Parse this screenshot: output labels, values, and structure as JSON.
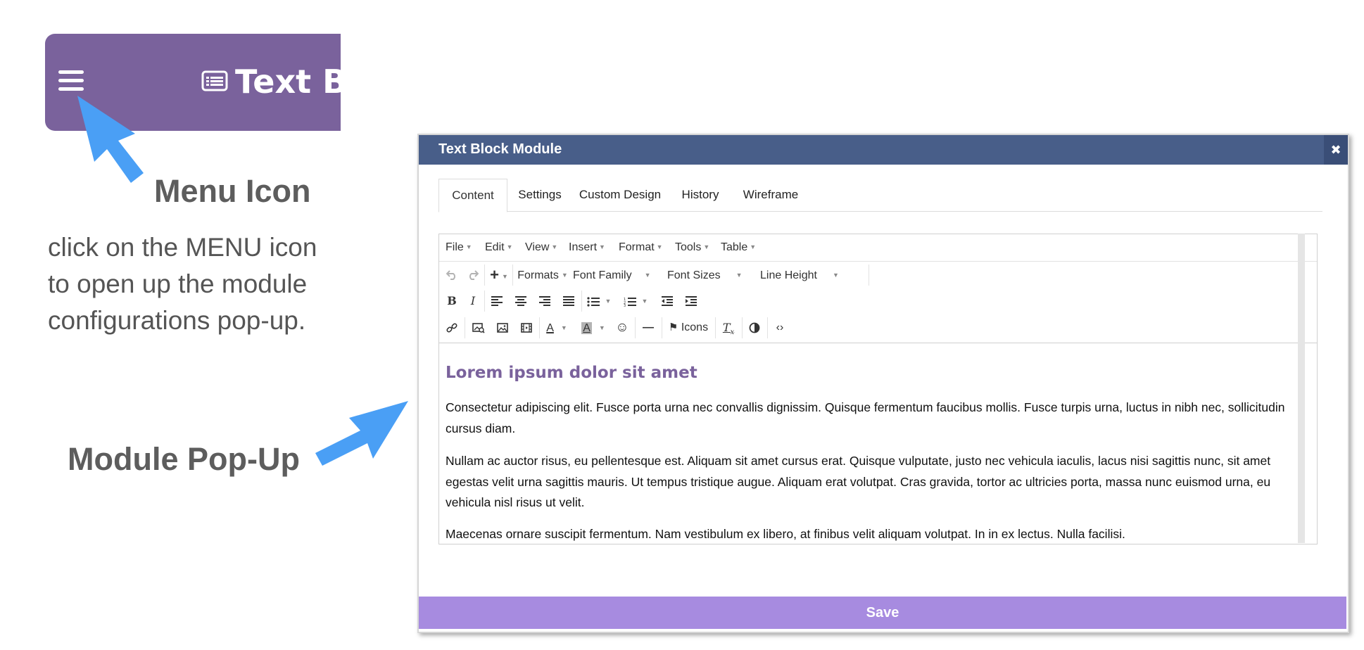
{
  "topbar": {
    "title": "Text Bl"
  },
  "labels": {
    "menu_icon": "Menu Icon",
    "instructions": "click on the MENU icon to open up the module configurations pop-up.",
    "module_popup": "Module Pop-Up"
  },
  "modal": {
    "title": "Text Block Module",
    "close_symbol": "✖",
    "tabs": [
      "Content",
      "Settings",
      "Custom Design",
      "History",
      "Wireframe"
    ],
    "active_tab": "Content",
    "save_label": "Save"
  },
  "editor": {
    "menu": [
      "File",
      "Edit",
      "View",
      "Insert",
      "Format",
      "Tools",
      "Table"
    ],
    "toolbar": {
      "formats": "Formats",
      "font_family": "Font Family",
      "font_sizes": "Font Sizes",
      "line_height": "Line Height",
      "icons_label": "Icons"
    },
    "content": {
      "heading": "Lorem ipsum dolor sit amet",
      "paragraphs": [
        "Consectetur adipiscing elit. Fusce porta urna nec convallis dignissim. Quisque fermentum faucibus mollis. Fusce turpis urna, luctus in nibh nec, sollicitudin cursus diam.",
        "Nullam ac auctor risus, eu pellentesque est. Aliquam sit amet cursus erat. Quisque vulputate, justo nec vehicula iaculis, lacus nisi sagittis nunc, sit amet egestas velit urna sagittis mauris. Ut tempus tristique augue. Aliquam erat volutpat. Cras gravida, tortor ac ultricies porta, massa nunc euismod urna, eu vehicula nisl risus ut velit.",
        "Maecenas ornare suscipit fermentum. Nam vestibulum ex libero, at finibus velit aliquam volutpat. In in ex lectus. Nulla facilisi."
      ]
    }
  },
  "colors": {
    "topbar": "#7a629c",
    "modal_header": "#485e89",
    "save_bar": "#a78be0",
    "arrow": "#4a9ff5",
    "heading_purple": "#7a629c"
  }
}
